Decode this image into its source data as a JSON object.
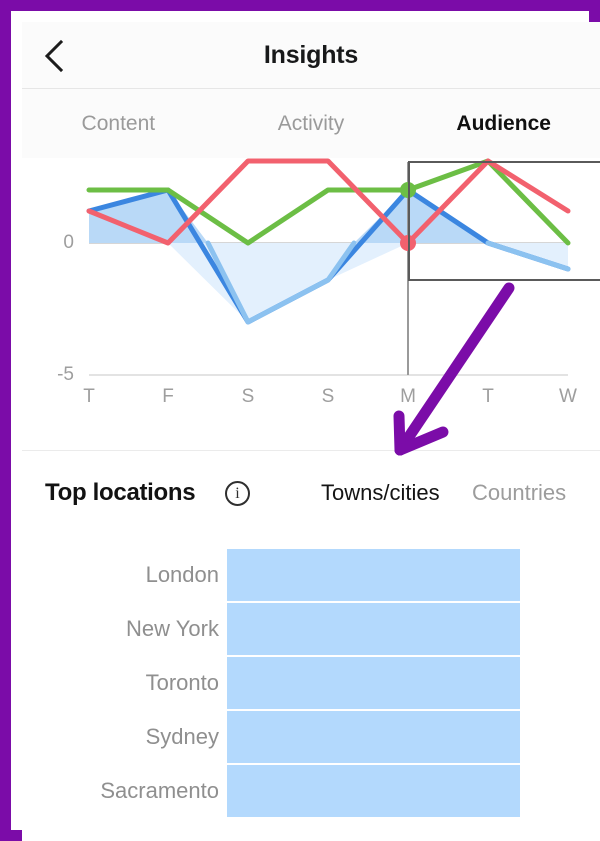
{
  "app": {
    "accent_purple": "#7b0ca8"
  },
  "header": {
    "title": "Insights",
    "back_icon": "chevron-left-icon"
  },
  "tabs": [
    {
      "label": "Content",
      "active": false
    },
    {
      "label": "Activity",
      "active": false
    },
    {
      "label": "Audience",
      "active": true
    }
  ],
  "chart_data": {
    "type": "line",
    "title": "",
    "xlabel": "",
    "ylabel": "",
    "categories": [
      "T",
      "F",
      "S",
      "S",
      "M",
      "T",
      "W"
    ],
    "ylim": [
      -5,
      3
    ],
    "yticks": [
      0,
      -5
    ],
    "ytick_labels": [
      "0",
      "-5"
    ],
    "grid": true,
    "legend_position": "none",
    "selected_category": "M",
    "series": [
      {
        "name": "green",
        "color": "#6cbe45",
        "values": [
          2,
          2,
          0,
          2,
          2,
          3.1,
          0
        ]
      },
      {
        "name": "blue",
        "color": "#3b86e0",
        "fill": "#b9d9f7",
        "values": [
          1.2,
          2,
          -3,
          -1.4,
          2,
          0,
          -1
        ]
      },
      {
        "name": "red",
        "color": "#f2616e",
        "values": [
          1.2,
          0,
          3.1,
          3.1,
          0,
          3.1,
          1.2
        ]
      }
    ],
    "markers": [
      {
        "series": "green",
        "category": "M",
        "value": 2,
        "color": "#6cbe45"
      },
      {
        "series": "red",
        "category": "M",
        "value": 0,
        "color": "#f2616e"
      }
    ]
  },
  "locations": {
    "title": "Top locations",
    "info_icon": "info-circle-icon",
    "toggles": [
      {
        "label": "Towns/cities",
        "active": true
      },
      {
        "label": "Countries",
        "active": false
      }
    ],
    "bar_color": "#b3d9fd",
    "rows": [
      {
        "name": "London",
        "value": 100
      },
      {
        "name": "New York",
        "value": 100
      },
      {
        "name": "Toronto",
        "value": 100
      },
      {
        "name": "Sydney",
        "value": 100
      },
      {
        "name": "Sacramento",
        "value": 100
      }
    ]
  },
  "annotation": {
    "arrow_color": "#7b0ca8",
    "points_to": "Towns/cities"
  }
}
